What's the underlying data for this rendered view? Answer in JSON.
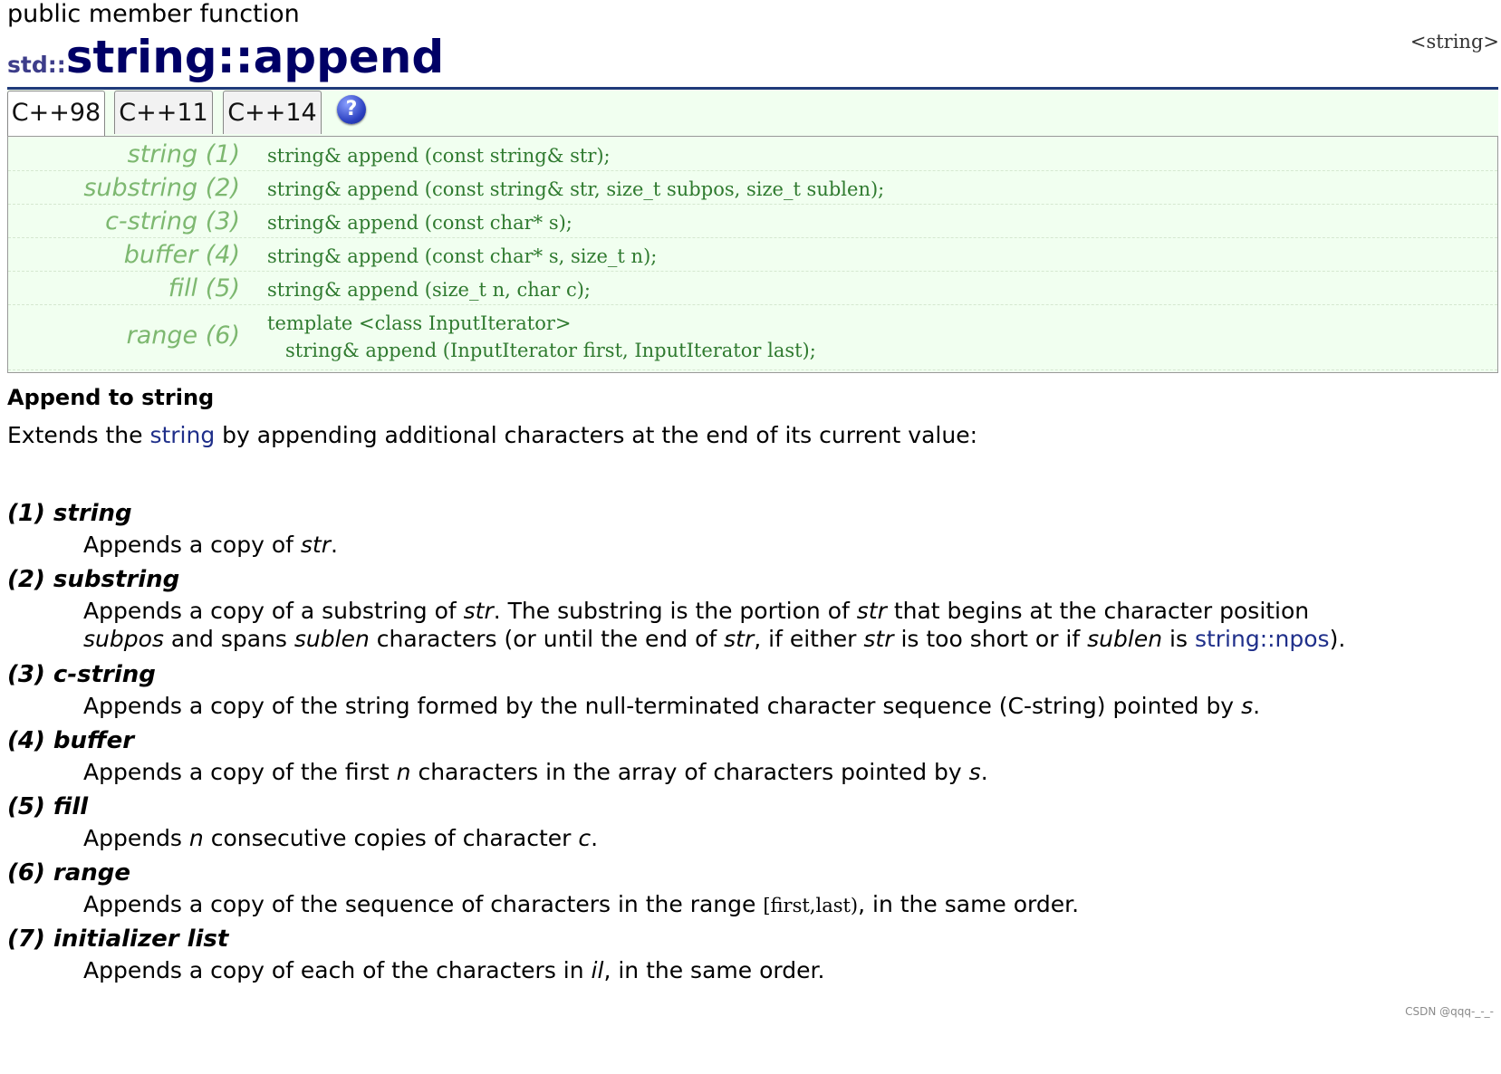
{
  "header": {
    "kind": "public member function",
    "namespace": "std::",
    "name": "string::append",
    "header_ref": "<string>"
  },
  "tabs": [
    {
      "label": "C++98"
    },
    {
      "label": "C++11"
    },
    {
      "label": "C++14"
    }
  ],
  "help_icon": {
    "glyph": "?"
  },
  "prototypes": [
    {
      "label": "string (1)",
      "code": "string& append (const string& str);"
    },
    {
      "label": "substring (2)",
      "code": "string& append (const string& str, size_t subpos, size_t sublen);"
    },
    {
      "label": "c-string (3)",
      "code": "string& append (const char* s);"
    },
    {
      "label": "buffer (4)",
      "code": "string& append (const char* s, size_t n);"
    },
    {
      "label": "fill (5)",
      "code": "string& append (size_t n, char c);"
    },
    {
      "label": "range (6)",
      "code_line1": "template <class InputIterator>",
      "code_line2": "   string& append (InputIterator first, InputIterator last);"
    }
  ],
  "section": {
    "title": "Append to string",
    "intro_pre": "Extends the ",
    "intro_link": "string",
    "intro_post": " by appending additional characters at the end of its current value:"
  },
  "items": {
    "i1": {
      "term": "(1) string",
      "t1": "Appends a copy of ",
      "e1": "str",
      "t2": "."
    },
    "i2": {
      "term": "(2) substring",
      "l1_t1": "Appends a copy of a substring of ",
      "l1_e1": "str",
      "l1_t2": ". The substring is the portion of ",
      "l1_e2": "str",
      "l1_t3": " that begins at the character position",
      "l2_e1": "subpos",
      "l2_t1": " and spans ",
      "l2_e2": "sublen",
      "l2_t2": " characters (or until the end of ",
      "l2_e3": "str",
      "l2_t3": ", if either ",
      "l2_e4": "str",
      "l2_t4": " is too short or if ",
      "l2_e5": "sublen",
      "l2_t5": " is ",
      "l2_link": "string::npos",
      "l2_t6": ")."
    },
    "i3": {
      "term": "(3) c-string",
      "t1": "Appends a copy of the string formed by the null-terminated character sequence (C-string) pointed by ",
      "e1": "s",
      "t2": "."
    },
    "i4": {
      "term": "(4) buffer",
      "t1": "Appends a copy of the first ",
      "e1": "n",
      "t2": " characters in the array of characters pointed by ",
      "e2": "s",
      "t3": "."
    },
    "i5": {
      "term": "(5) fill",
      "t1": "Appends ",
      "e1": "n",
      "t2": " consecutive copies of character ",
      "e2": "c",
      "t3": "."
    },
    "i6": {
      "term": "(6) range",
      "t1": "Appends a copy of the sequence of characters in the range ",
      "code": "[first,last)",
      "t2": ", in the same order."
    },
    "i7": {
      "term": "(7) initializer list",
      "t1": "Appends a copy of each of the characters in ",
      "e1": "il",
      "t2": ", in the same order."
    }
  },
  "watermark": "CSDN @qqq-_-_-"
}
